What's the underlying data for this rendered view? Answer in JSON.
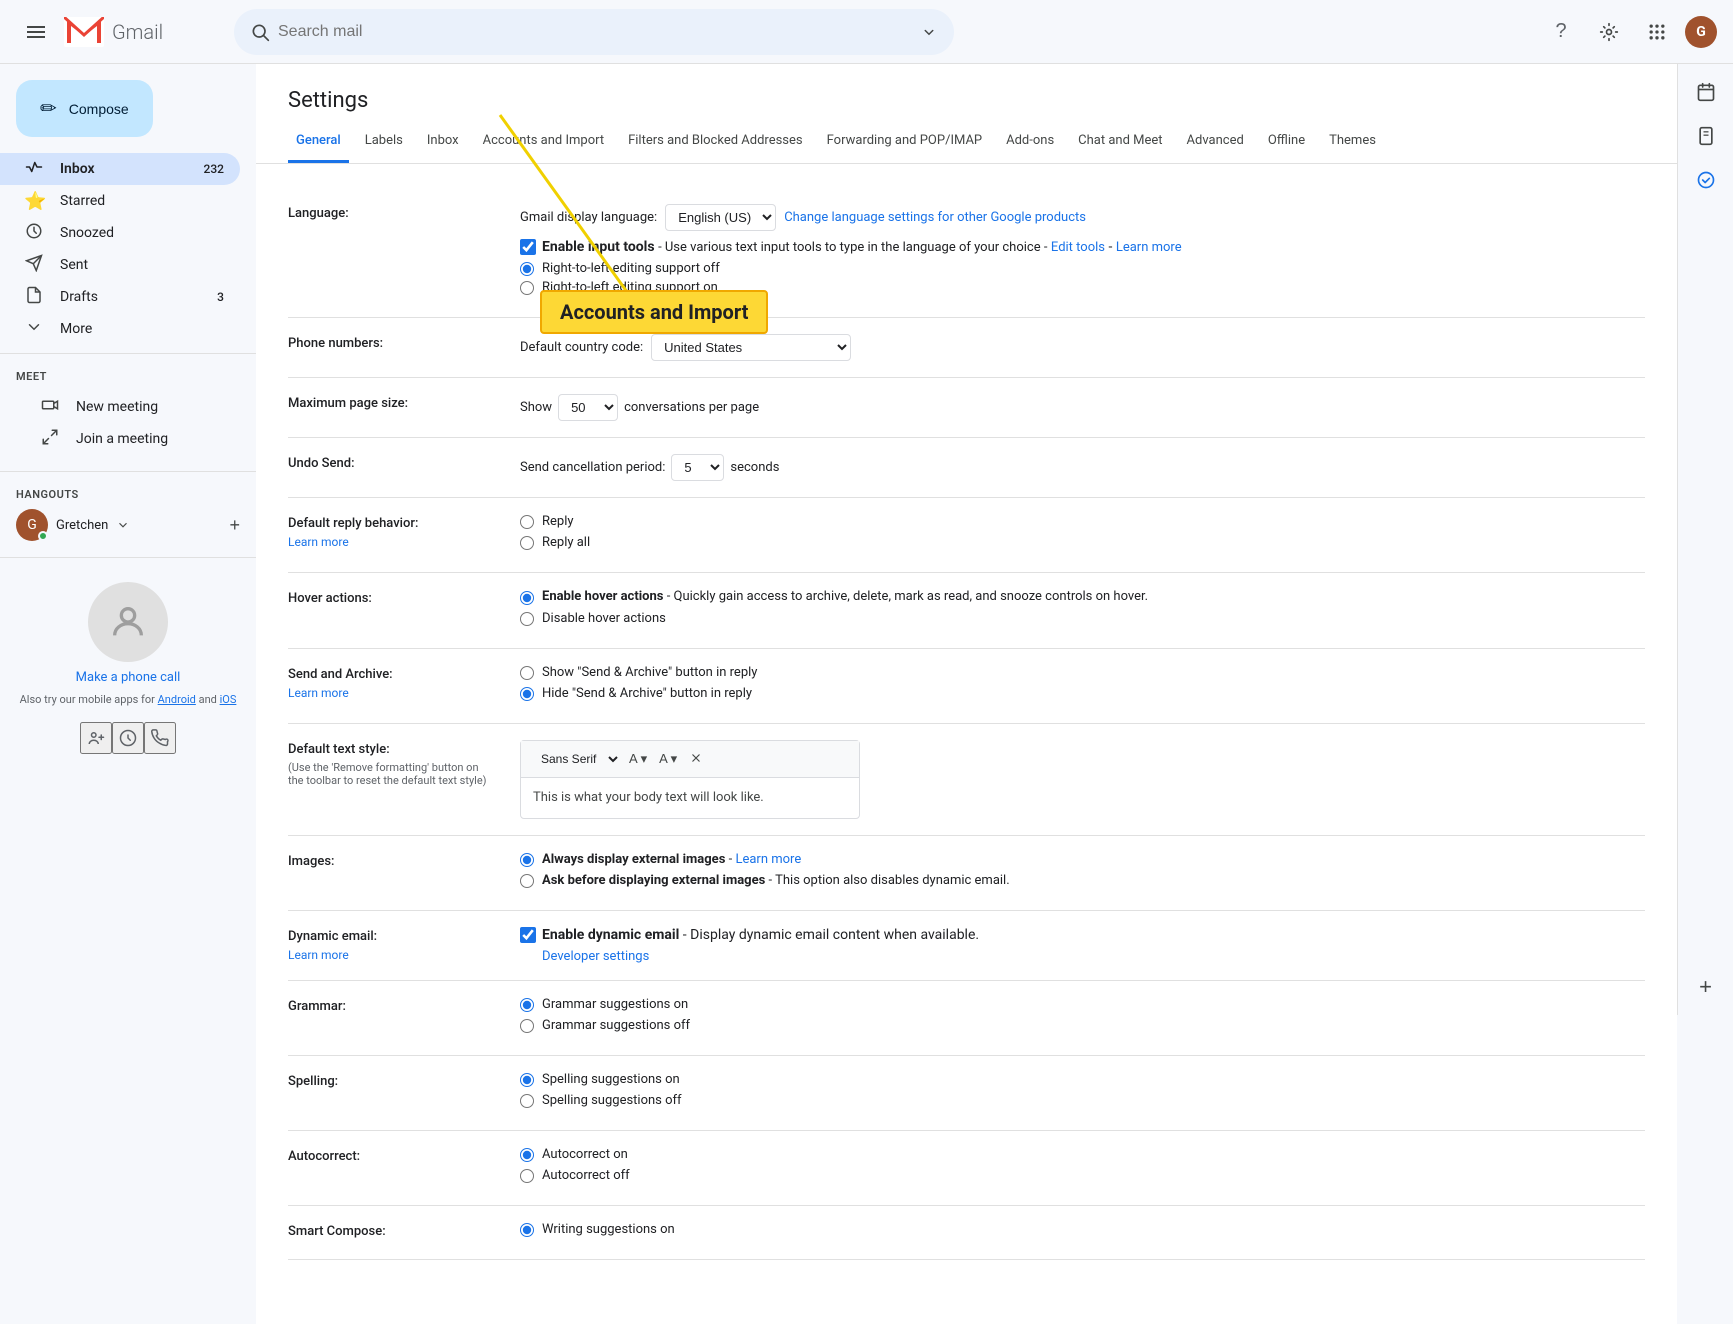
{
  "topbar": {
    "search_placeholder": "Search mail",
    "help_tooltip": "Help",
    "settings_tooltip": "Settings",
    "apps_tooltip": "Google apps",
    "avatar_letter": "G"
  },
  "left_sidebar": {
    "compose_label": "Compose",
    "nav_items": [
      {
        "id": "inbox",
        "label": "Inbox",
        "icon": "📥",
        "count": "232",
        "active": false
      },
      {
        "id": "starred",
        "label": "Starred",
        "icon": "⭐",
        "count": "",
        "active": false
      },
      {
        "id": "snoozed",
        "label": "Snoozed",
        "icon": "🕐",
        "count": "",
        "active": false
      },
      {
        "id": "sent",
        "label": "Sent",
        "icon": "📤",
        "count": "",
        "active": false
      },
      {
        "id": "drafts",
        "label": "Drafts",
        "icon": "📝",
        "count": "3",
        "active": false
      },
      {
        "id": "more",
        "label": "More",
        "icon": "›",
        "count": "",
        "active": false
      }
    ],
    "meet_section": "Meet",
    "new_meeting_label": "New meeting",
    "join_meeting_label": "Join a meeting",
    "hangouts_section": "Hangouts",
    "hangouts_user": "Gretchen",
    "phone_cta": "Make a phone call",
    "phone_info_1": "Also try our mobile apps for",
    "phone_link_android": "Android",
    "phone_info_and": "and",
    "phone_link_ios": "iOS"
  },
  "settings": {
    "title": "Settings",
    "tabs": [
      {
        "id": "general",
        "label": "General",
        "active": true
      },
      {
        "id": "labels",
        "label": "Labels",
        "active": false
      },
      {
        "id": "inbox",
        "label": "Inbox",
        "active": false
      },
      {
        "id": "accounts",
        "label": "Accounts and Import",
        "active": false
      },
      {
        "id": "filters",
        "label": "Filters and Blocked Addresses",
        "active": false
      },
      {
        "id": "forwarding",
        "label": "Forwarding and POP/IMAP",
        "active": false
      },
      {
        "id": "addons",
        "label": "Add-ons",
        "active": false
      },
      {
        "id": "chat",
        "label": "Chat and Meet",
        "active": false
      },
      {
        "id": "advanced",
        "label": "Advanced",
        "active": false
      },
      {
        "id": "offline",
        "label": "Offline",
        "active": false
      },
      {
        "id": "themes",
        "label": "Themes",
        "active": false
      }
    ],
    "rows": [
      {
        "id": "language",
        "label": "Language:",
        "sub_label": null,
        "learn_more": null
      },
      {
        "id": "phone",
        "label": "Phone numbers:",
        "sub_label": null,
        "learn_more": null
      },
      {
        "id": "page_size",
        "label": "Maximum page size:",
        "sub_label": null,
        "learn_more": null
      },
      {
        "id": "undo_send",
        "label": "Undo Send:",
        "sub_label": null,
        "learn_more": null
      },
      {
        "id": "reply",
        "label": "Default reply behavior:",
        "sub_label": null,
        "learn_more": "Learn more"
      },
      {
        "id": "hover",
        "label": "Hover actions:",
        "sub_label": null,
        "learn_more": null
      },
      {
        "id": "send_archive",
        "label": "Send and Archive:",
        "sub_label": null,
        "learn_more": "Learn more"
      },
      {
        "id": "text_style",
        "label": "Default text style:",
        "sub_label": "(Use the 'Remove formatting' button on the toolbar to reset the default text style)",
        "learn_more": null
      },
      {
        "id": "images",
        "label": "Images:",
        "sub_label": null,
        "learn_more": null
      },
      {
        "id": "dynamic_email",
        "label": "Dynamic email:",
        "sub_label": null,
        "learn_more": "Learn more"
      },
      {
        "id": "grammar",
        "label": "Grammar:",
        "sub_label": null,
        "learn_more": null
      },
      {
        "id": "spelling",
        "label": "Spelling:",
        "sub_label": null,
        "learn_more": null
      },
      {
        "id": "autocorrect",
        "label": "Autocorrect:",
        "sub_label": null,
        "learn_more": null
      },
      {
        "id": "smart_compose",
        "label": "Smart Compose:",
        "sub_label": null,
        "learn_more": null
      }
    ],
    "language": {
      "dropdown_label": "Gmail display language:",
      "selected": "English (US)",
      "change_link": "Change language settings for other Google products",
      "checkbox_label": "Enable input tools",
      "checkbox_desc": "- Use various text input tools to type in the language of your choice -",
      "edit_tools_link": "Edit tools",
      "learn_more_link": "Learn more",
      "rtl_off": "Right-to-left editing support off",
      "rtl_on": "Right-to-left editing support on"
    },
    "phone": {
      "dropdown_label": "Default country code:",
      "selected": "United States"
    },
    "page_size": {
      "show_label": "Show",
      "selected": "50",
      "conversations_label": "conversations per page"
    },
    "undo_send": {
      "label": "Send cancellation period:",
      "selected": "5",
      "seconds_label": "seconds"
    },
    "reply": {
      "reply_label": "Reply",
      "reply_all_label": "Reply all"
    },
    "hover": {
      "enable_label": "Enable hover actions",
      "enable_desc": "- Quickly gain access to archive, delete, mark as read, and snooze controls on hover.",
      "disable_label": "Disable hover actions"
    },
    "send_archive": {
      "show_label": "Show \"Send & Archive\" button in reply",
      "hide_label": "Hide \"Send & Archive\" button in reply"
    },
    "text_style": {
      "font": "Sans Serif",
      "preview_text": "This is what your body text will look like."
    },
    "images": {
      "always_label": "Always display external images",
      "always_link": "Learn more",
      "ask_label": "Ask before displaying external images",
      "ask_desc": "- This option also disables dynamic email."
    },
    "dynamic_email": {
      "checkbox_label": "Enable dynamic email",
      "checkbox_desc": "- Display dynamic email content when available.",
      "developer_link": "Developer settings"
    },
    "grammar": {
      "on_label": "Grammar suggestions on",
      "off_label": "Grammar suggestions off"
    },
    "spelling": {
      "on_label": "Spelling suggestions on",
      "off_label": "Spelling suggestions off"
    },
    "autocorrect": {
      "on_label": "Autocorrect on",
      "off_label": "Autocorrect off"
    },
    "smart_compose": {
      "on_label": "Writing suggestions on"
    }
  },
  "tooltip": {
    "text": "Accounts and Import"
  },
  "right_sidebar": {
    "icons": [
      "📅",
      "✉️",
      "💬"
    ]
  }
}
